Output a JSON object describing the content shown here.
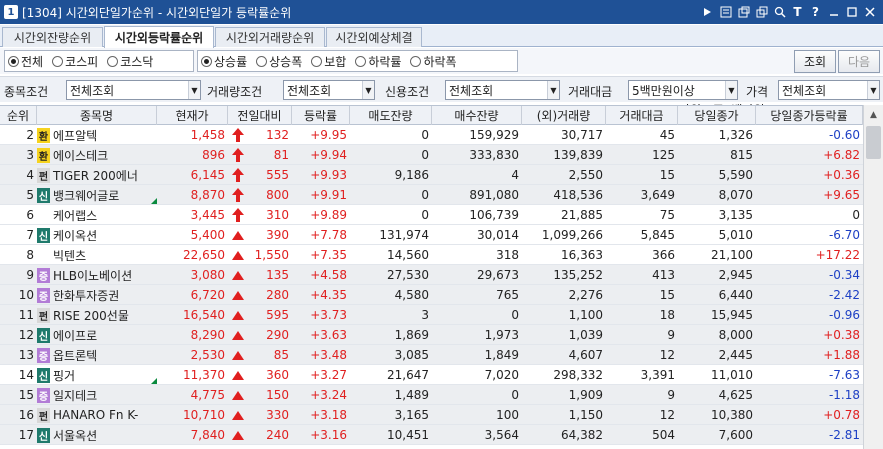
{
  "titlebar": {
    "num": "1",
    "title": "[1304] 시간외단일가순위 - 시간외단일가 등락률순위"
  },
  "tabs": [
    "시간외잔량순위",
    "시간외등락률순위",
    "시간외거래량순위",
    "시간외예상체결"
  ],
  "market_radios": [
    "전체",
    "코스피",
    "코스닥"
  ],
  "type_radios": [
    "상승률",
    "상승폭",
    "보합",
    "하락률",
    "하락폭"
  ],
  "unit": "*단위 : 주, 백만원",
  "buttons": {
    "query": "조회",
    "next": "다음"
  },
  "filters": {
    "item": {
      "label": "종목조건",
      "value": "전체조회"
    },
    "volume": {
      "label": "거래량조건",
      "value": "전체조회"
    },
    "credit": {
      "label": "신용조건",
      "value": "전체조회"
    },
    "amount": {
      "label": "거래대금",
      "value": "5백만원이상"
    },
    "price": {
      "label": "가격",
      "value": "전체조회"
    }
  },
  "columns": [
    "순위",
    "종목명",
    "현재가",
    "전일대비",
    "등락률",
    "매도잔량",
    "매수잔량",
    "(외)거래량",
    "거래대금",
    "당일종가",
    "당일종가등락률"
  ],
  "colors": {
    "up": "#e01f1f",
    "down": "#1d3fc4",
    "tag_hwan": "#f6d31f",
    "tag_pyeon": "#d8d8d8",
    "tag_sin": "#1f7a6c",
    "tag_jeung": "#b27cd6"
  },
  "rows": [
    {
      "rank": "2",
      "tag": "환",
      "name": "에프알텍",
      "price": "1,458",
      "arrow": "up",
      "change": "132",
      "rate": "+9.95",
      "sell": "0",
      "buy": "159,929",
      "volume": "30,717",
      "amount": "45",
      "close": "1,326",
      "close_rate": "-0.60",
      "close_dir": "down"
    },
    {
      "rank": "3",
      "tag": "환",
      "name": "에이스테크",
      "price": "896",
      "arrow": "up",
      "change": "81",
      "rate": "+9.94",
      "sell": "0",
      "buy": "333,830",
      "volume": "139,839",
      "amount": "125",
      "close": "815",
      "close_rate": "+6.82",
      "close_dir": "up"
    },
    {
      "rank": "4",
      "tag": "펀",
      "name": "TIGER 200에너",
      "price": "6,145",
      "arrow": "up",
      "change": "555",
      "rate": "+9.93",
      "sell": "9,186",
      "buy": "4",
      "volume": "2,550",
      "amount": "15",
      "close": "5,590",
      "close_rate": "+0.36",
      "close_dir": "up"
    },
    {
      "rank": "5",
      "tag": "신",
      "name": "뱅크웨어글로",
      "price": "8,870",
      "arrow": "up",
      "change": "800",
      "rate": "+9.91",
      "sell": "0",
      "buy": "891,080",
      "volume": "418,536",
      "amount": "3,649",
      "close": "8,070",
      "close_rate": "+9.65",
      "close_dir": "up",
      "flag": true
    },
    {
      "rank": "6",
      "tag": "",
      "name": "케어랩스",
      "price": "3,445",
      "arrow": "up",
      "change": "310",
      "rate": "+9.89",
      "sell": "0",
      "buy": "106,739",
      "volume": "21,885",
      "amount": "75",
      "close": "3,135",
      "close_rate": "0",
      "close_dir": "flat"
    },
    {
      "rank": "7",
      "tag": "신",
      "name": "케이옥션",
      "price": "5,400",
      "arrow": "tri",
      "change": "390",
      "rate": "+7.78",
      "sell": "131,974",
      "buy": "30,014",
      "volume": "1,099,266",
      "amount": "5,845",
      "close": "5,010",
      "close_rate": "-6.70",
      "close_dir": "down"
    },
    {
      "rank": "8",
      "tag": "",
      "name": "빅텐츠",
      "price": "22,650",
      "arrow": "tri",
      "change": "1,550",
      "rate": "+7.35",
      "sell": "14,560",
      "buy": "318",
      "volume": "16,363",
      "amount": "366",
      "close": "21,100",
      "close_rate": "+17.22",
      "close_dir": "up"
    },
    {
      "rank": "9",
      "tag": "증",
      "name": "HLB이노베이션",
      "price": "3,080",
      "arrow": "tri",
      "change": "135",
      "rate": "+4.58",
      "sell": "27,530",
      "buy": "29,673",
      "volume": "135,252",
      "amount": "413",
      "close": "2,945",
      "close_rate": "-0.34",
      "close_dir": "down"
    },
    {
      "rank": "10",
      "tag": "증",
      "name": "한화투자증권",
      "price": "6,720",
      "arrow": "tri",
      "change": "280",
      "rate": "+4.35",
      "sell": "4,580",
      "buy": "765",
      "volume": "2,276",
      "amount": "15",
      "close": "6,440",
      "close_rate": "-2.42",
      "close_dir": "down"
    },
    {
      "rank": "11",
      "tag": "펀",
      "name": "RISE 200선물",
      "price": "16,540",
      "arrow": "tri",
      "change": "595",
      "rate": "+3.73",
      "sell": "3",
      "buy": "0",
      "volume": "1,100",
      "amount": "18",
      "close": "15,945",
      "close_rate": "-0.96",
      "close_dir": "down"
    },
    {
      "rank": "12",
      "tag": "신",
      "name": "에이프로",
      "price": "8,290",
      "arrow": "tri",
      "change": "290",
      "rate": "+3.63",
      "sell": "1,869",
      "buy": "1,973",
      "volume": "1,039",
      "amount": "9",
      "close": "8,000",
      "close_rate": "+0.38",
      "close_dir": "up"
    },
    {
      "rank": "13",
      "tag": "증",
      "name": "옵트론텍",
      "price": "2,530",
      "arrow": "tri",
      "change": "85",
      "rate": "+3.48",
      "sell": "3,085",
      "buy": "1,849",
      "volume": "4,607",
      "amount": "12",
      "close": "2,445",
      "close_rate": "+1.88",
      "close_dir": "up"
    },
    {
      "rank": "14",
      "tag": "신",
      "name": "핑거",
      "price": "11,370",
      "arrow": "tri",
      "change": "360",
      "rate": "+3.27",
      "sell": "21,647",
      "buy": "7,020",
      "volume": "298,332",
      "amount": "3,391",
      "close": "11,010",
      "close_rate": "-7.63",
      "close_dir": "down",
      "flag": true
    },
    {
      "rank": "15",
      "tag": "증",
      "name": "일지테크",
      "price": "4,775",
      "arrow": "tri",
      "change": "150",
      "rate": "+3.24",
      "sell": "1,489",
      "buy": "0",
      "volume": "1,909",
      "amount": "9",
      "close": "4,625",
      "close_rate": "-1.18",
      "close_dir": "down"
    },
    {
      "rank": "16",
      "tag": "펀",
      "name": "HANARO Fn K-",
      "price": "10,710",
      "arrow": "tri",
      "change": "330",
      "rate": "+3.18",
      "sell": "3,165",
      "buy": "100",
      "volume": "1,150",
      "amount": "12",
      "close": "10,380",
      "close_rate": "+0.78",
      "close_dir": "up"
    },
    {
      "rank": "17",
      "tag": "신",
      "name": "서울옥션",
      "price": "7,840",
      "arrow": "tri",
      "change": "240",
      "rate": "+3.16",
      "sell": "10,451",
      "buy": "3,564",
      "volume": "64,382",
      "amount": "504",
      "close": "7,600",
      "close_rate": "-2.81",
      "close_dir": "down"
    }
  ]
}
